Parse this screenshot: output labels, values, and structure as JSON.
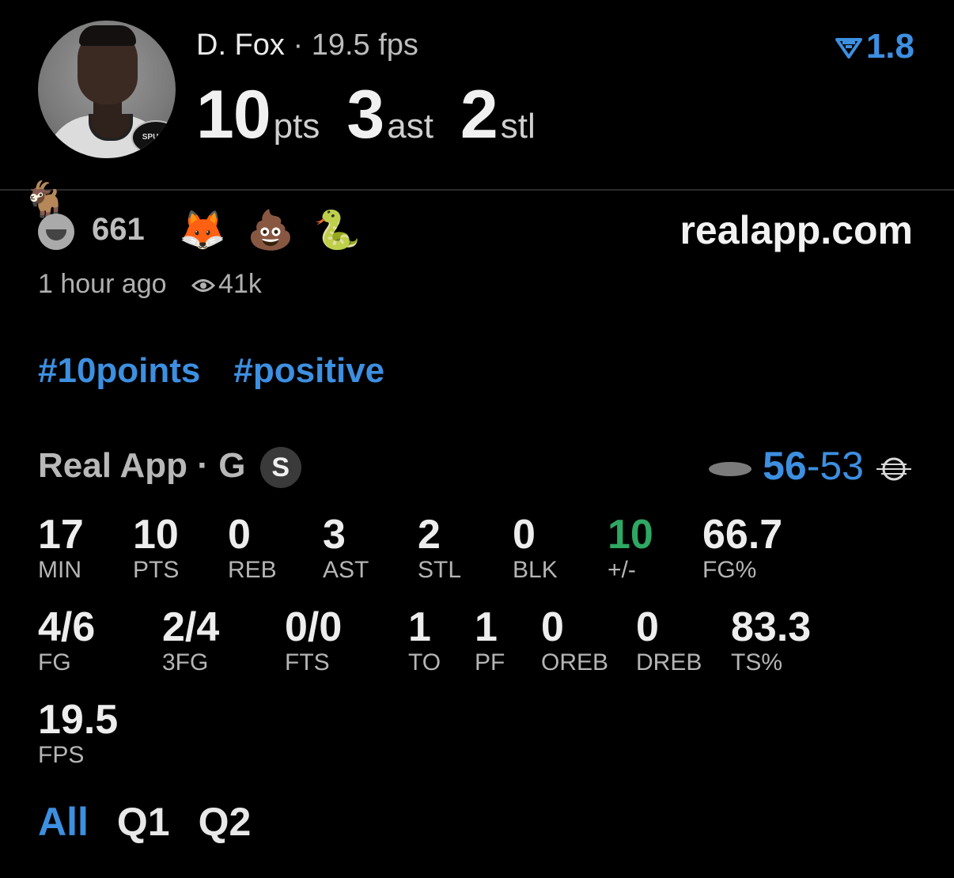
{
  "header": {
    "player_name": "D. Fox",
    "separator": "·",
    "fps_text": "19.5 fps",
    "stats": [
      {
        "value": "10",
        "unit": "pts"
      },
      {
        "value": "3",
        "unit": "ast"
      },
      {
        "value": "2",
        "unit": "stl"
      }
    ],
    "rating": "1.8",
    "rating_color": "#3d8fe0",
    "avatar_team_badge": "SPURS"
  },
  "reactions": {
    "goat_emoji": "🐐",
    "count": "661",
    "emojis": [
      "🦊",
      "💩",
      "🐍"
    ],
    "site": "realapp.com"
  },
  "meta": {
    "time": "1 hour ago",
    "views": "41k"
  },
  "tags": [
    "#10points",
    "#positive"
  ],
  "game": {
    "source": "Real App",
    "separator": "·",
    "position": "G",
    "team_badge": "S",
    "score_home": "56",
    "score_sep": "-",
    "score_away": "53"
  },
  "stats_rows": [
    [
      {
        "value": "17",
        "label": "MIN"
      },
      {
        "value": "10",
        "label": "PTS"
      },
      {
        "value": "0",
        "label": "REB"
      },
      {
        "value": "3",
        "label": "AST"
      },
      {
        "value": "2",
        "label": "STL"
      },
      {
        "value": "0",
        "label": "BLK"
      },
      {
        "value": "10",
        "label": "+/-"
      },
      {
        "value": "66.7",
        "label": "FG%"
      }
    ],
    [
      {
        "value": "4/6",
        "label": "FG"
      },
      {
        "value": "2/4",
        "label": "3FG"
      },
      {
        "value": "0/0",
        "label": "FTS"
      },
      {
        "value": "1",
        "label": "TO"
      },
      {
        "value": "1",
        "label": "PF"
      },
      {
        "value": "0",
        "label": "OREB"
      },
      {
        "value": "0",
        "label": "DREB"
      },
      {
        "value": "83.3",
        "label": "TS%"
      }
    ],
    [
      {
        "value": "19.5",
        "label": "FPS"
      }
    ]
  ],
  "tabs": [
    "All",
    "Q1",
    "Q2"
  ],
  "colors": {
    "accent": "#3d8fe0",
    "positive": "#2ea862",
    "background": "#000000"
  }
}
